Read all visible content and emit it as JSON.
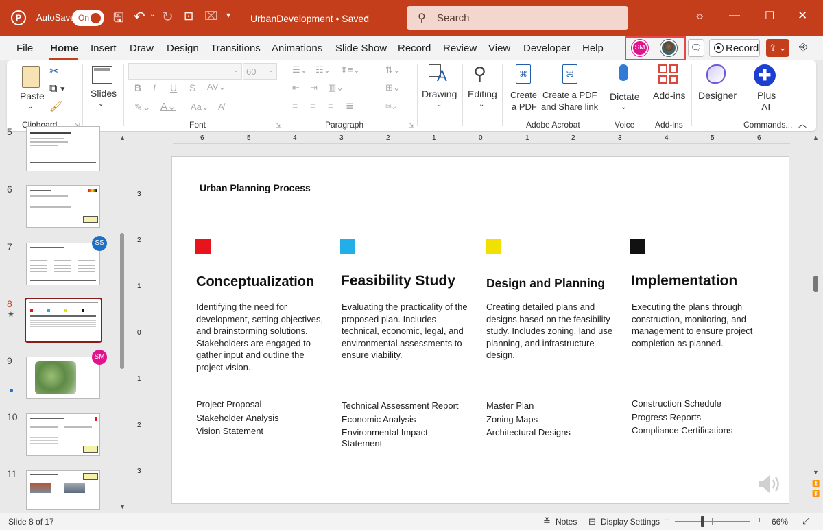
{
  "titlebar": {
    "autosave_label": "AutoSave",
    "autosave_state": "On",
    "doc_title": "UrbanDevelopment • Saved",
    "search_placeholder": "Search"
  },
  "menu": {
    "tabs": [
      "File",
      "Home",
      "Insert",
      "Draw",
      "Design",
      "Transitions",
      "Animations",
      "Slide Show",
      "Record",
      "Review",
      "View",
      "Developer",
      "Help"
    ],
    "active": "Home",
    "collaborator_initials": "SM",
    "record_label": "Record"
  },
  "ribbon": {
    "clipboard": {
      "paste": "Paste",
      "group": "Clipboard"
    },
    "slides": {
      "label": "Slides"
    },
    "font": {
      "size": "60",
      "group": "Font"
    },
    "paragraph": {
      "group": "Paragraph"
    },
    "drawing": {
      "label": "Drawing"
    },
    "editing": {
      "label": "Editing"
    },
    "acrobat": {
      "pdf1_l1": "Create",
      "pdf1_l2": "a PDF",
      "pdf2_l1": "Create a PDF",
      "pdf2_l2": "and Share link",
      "group": "Adobe Acrobat"
    },
    "voice": {
      "label": "Dictate",
      "group": "Voice"
    },
    "addins": {
      "label": "Add-ins",
      "group": "Add-ins"
    },
    "designer": {
      "label": "Designer"
    },
    "plusai": {
      "l1": "Plus",
      "l2": "AI",
      "group": "Commands..."
    }
  },
  "thumbnails": [
    {
      "num": "5",
      "badge": ""
    },
    {
      "num": "6",
      "badge": ""
    },
    {
      "num": "7",
      "badge": "SS"
    },
    {
      "num": "8",
      "badge": ""
    },
    {
      "num": "9",
      "badge": "SM"
    },
    {
      "num": "10",
      "badge": ""
    },
    {
      "num": "11",
      "badge": ""
    }
  ],
  "ruler": {
    "h_ticks": [
      "6",
      "5",
      "4",
      "3",
      "2",
      "1",
      "0",
      "1",
      "2",
      "3",
      "4",
      "5",
      "6"
    ],
    "v_ticks": [
      "3",
      "2",
      "1",
      "0",
      "1",
      "2",
      "3"
    ]
  },
  "slide": {
    "title": "Urban Planning Process",
    "columns": [
      {
        "color": "#e8141c",
        "heading": "Conceptualization",
        "text": "Identifying the need for development, setting objectives, and brainstorming solutions. Stakeholders are engaged to gather input and outline the project vision.",
        "deliverables": [
          "Project Proposal",
          "Stakeholder Analysis",
          "Vision Statement"
        ]
      },
      {
        "color": "#22aee6",
        "heading": "Feasibility Study",
        "text": "Evaluating the practicality of the proposed plan. Includes technical, economic, legal, and environmental assessments to ensure viability.",
        "deliverables": [
          "Technical Assessment Report",
          "Economic Analysis",
          "Environmental Impact Statement"
        ]
      },
      {
        "color": "#f2e000",
        "heading": "Design and Planning",
        "text": "Creating detailed plans and designs based on the feasibility study. Includes zoning, land use planning, and infrastructure design.",
        "deliverables": [
          "Master Plan",
          "Zoning Maps",
          "Architectural Designs"
        ]
      },
      {
        "color": "#111111",
        "heading": "Implementation",
        "text": "Executing the plans through construction, monitoring, and management to ensure project completion as planned.",
        "deliverables": [
          "Construction Schedule",
          "Progress Reports",
          "Compliance Certifications"
        ]
      }
    ]
  },
  "status": {
    "slide_info": "Slide 8 of 17",
    "notes": "Notes",
    "display_settings": "Display Settings",
    "zoom": "66%"
  },
  "colors": {
    "accent": "#c43e1c",
    "highlight": "#e8474a",
    "avatar": "#e0138c"
  }
}
